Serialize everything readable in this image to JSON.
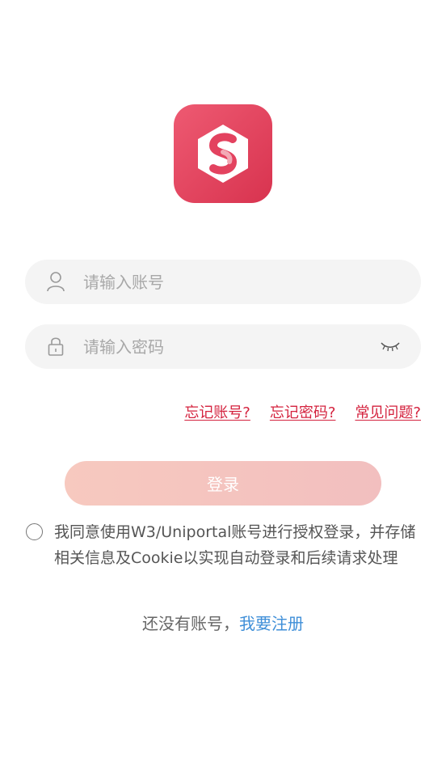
{
  "app": {
    "logo_icon": "app-logo-s-icon",
    "brand_color": "#e3425f"
  },
  "login": {
    "account_placeholder": "请输入账号",
    "password_placeholder": "请输入密码",
    "account_icon": "user-icon",
    "password_icon": "lock-icon",
    "toggle_icon": "eye-closed-icon"
  },
  "links": {
    "forgot_account": "忘记账号?",
    "forgot_password": "忘记密码?",
    "faq": "常见问题?",
    "link_color": "#d4223e"
  },
  "login_button": {
    "label": "登录"
  },
  "agreement": {
    "text": "我同意使用W3/Uniportal账号进行授权登录，并存储相关信息及Cookie以实现自动登录和后续请求处理",
    "checked": false
  },
  "register": {
    "prompt": "还没有账号，",
    "link": "我要注册",
    "link_color": "#3f8fd8"
  }
}
